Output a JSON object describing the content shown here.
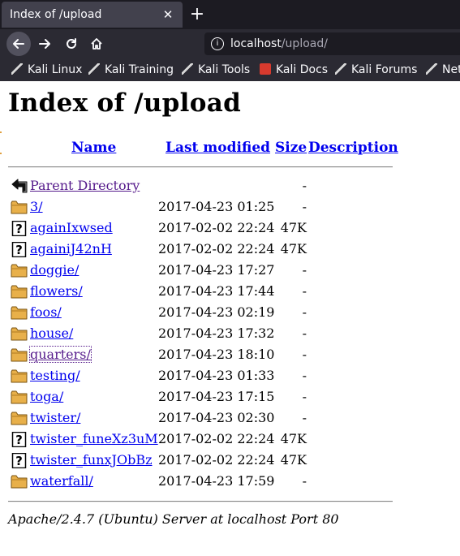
{
  "browser": {
    "tab_title": "Index of /upload",
    "tab_close": "✕",
    "new_tab": "+",
    "url_host": "localhost",
    "url_path": "/upload/",
    "nav": {
      "back_icon": "arrow-left-icon",
      "forward_icon": "arrow-right-icon",
      "reload_icon": "reload-icon",
      "home_icon": "home-icon"
    },
    "bookmarks": [
      {
        "label": "Kali Linux",
        "icon": "kali-dragon-icon"
      },
      {
        "label": "Kali Training",
        "icon": "kali-dragon-icon"
      },
      {
        "label": "Kali Tools",
        "icon": "kali-dragon-icon"
      },
      {
        "label": "Kali Docs",
        "icon": "kali-docs-icon"
      },
      {
        "label": "Kali Forums",
        "icon": "kali-dragon-icon"
      },
      {
        "label": "Net",
        "icon": "kali-dragon-icon"
      }
    ]
  },
  "page": {
    "title": "Index of /upload",
    "columns": {
      "name": "Name",
      "last_modified": "Last modified",
      "size": "Size",
      "description": "Description"
    },
    "rows": [
      {
        "name": "Parent Directory",
        "date": "",
        "size": "-",
        "type": "parent",
        "visited": true
      },
      {
        "name": "3/",
        "date": "2017-04-23 01:25",
        "size": "-",
        "type": "folder"
      },
      {
        "name": "againIxwsed",
        "date": "2017-02-02 22:24",
        "size": "47K",
        "type": "unknown"
      },
      {
        "name": "againiJ42nH",
        "date": "2017-02-02 22:24",
        "size": "47K",
        "type": "unknown"
      },
      {
        "name": "doggie/",
        "date": "2017-04-23 17:27",
        "size": "-",
        "type": "folder"
      },
      {
        "name": "flowers/",
        "date": "2017-04-23 17:44",
        "size": "-",
        "type": "folder"
      },
      {
        "name": "foos/",
        "date": "2017-04-23 02:19",
        "size": "-",
        "type": "folder"
      },
      {
        "name": "house/",
        "date": "2017-04-23 17:32",
        "size": "-",
        "type": "folder"
      },
      {
        "name": "quarters/",
        "date": "2017-04-23 18:10",
        "size": "-",
        "type": "folder",
        "visited": true,
        "focused": true
      },
      {
        "name": "testing/",
        "date": "2017-04-23 01:33",
        "size": "-",
        "type": "folder"
      },
      {
        "name": "toga/",
        "date": "2017-04-23 17:15",
        "size": "-",
        "type": "folder"
      },
      {
        "name": "twister/",
        "date": "2017-04-23 02:30",
        "size": "-",
        "type": "folder"
      },
      {
        "name": "twister_funeXz3uM",
        "date": "2017-02-02 22:24",
        "size": "47K",
        "type": "unknown"
      },
      {
        "name": "twister_funxJObBz",
        "date": "2017-02-02 22:24",
        "size": "47K",
        "type": "unknown"
      },
      {
        "name": "waterfall/",
        "date": "2017-04-23 17:59",
        "size": "-",
        "type": "folder"
      }
    ],
    "footer": "Apache/2.4.7 (Ubuntu) Server at localhost Port 80"
  },
  "colors": {
    "link": "#0000ee",
    "visited": "#551a8b",
    "chrome_dark": "#1c1b22",
    "chrome": "#2b2a33",
    "folder": "#e8b04a"
  }
}
